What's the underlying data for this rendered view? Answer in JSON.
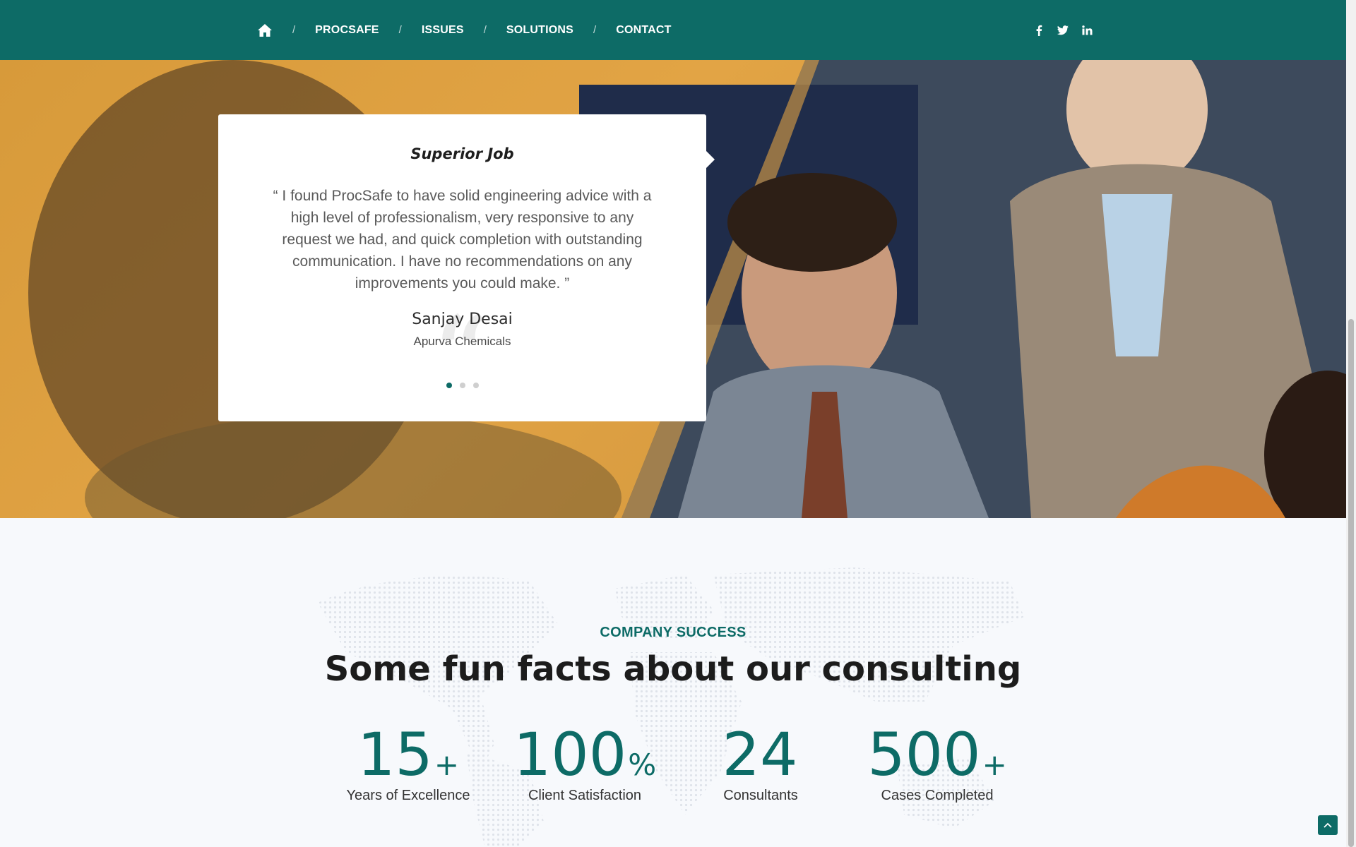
{
  "nav": {
    "home_icon": "home-icon",
    "separator": "/",
    "links": [
      "PROCSAFE",
      "ISSUES",
      "SOLUTIONS",
      "CONTACT"
    ],
    "social_icons": [
      "facebook-icon",
      "twitter-icon",
      "linkedin-icon"
    ]
  },
  "testimonial": {
    "title": "Superior Job",
    "quote": "“ I found ProcSafe to have solid engineering advice with a high level of professionalism, very responsive to any request we had, and quick completion with outstanding communication. I have no recommendations on any improvements you could make. ”",
    "name": "Sanjay Desai",
    "company": "Apurva Chemicals",
    "slide_count": 3,
    "active_slide": 1
  },
  "facts": {
    "eyebrow": "COMPANY SUCCESS",
    "heading": "Some fun facts about our consulting",
    "stats": [
      {
        "value": "15",
        "suffix": "+",
        "label": "Years of Excellence"
      },
      {
        "value": "100",
        "suffix": "%",
        "label": "Client Satisfaction"
      },
      {
        "value": "24",
        "suffix": "",
        "label": "Consultants"
      },
      {
        "value": "500",
        "suffix": "+",
        "label": "Cases Completed"
      }
    ]
  },
  "colors": {
    "brand": "#0d6b66",
    "hero_orange": "#e2a445",
    "text_dark": "#1c1c1c"
  },
  "scroll_top_icon": "chevron-up-icon"
}
